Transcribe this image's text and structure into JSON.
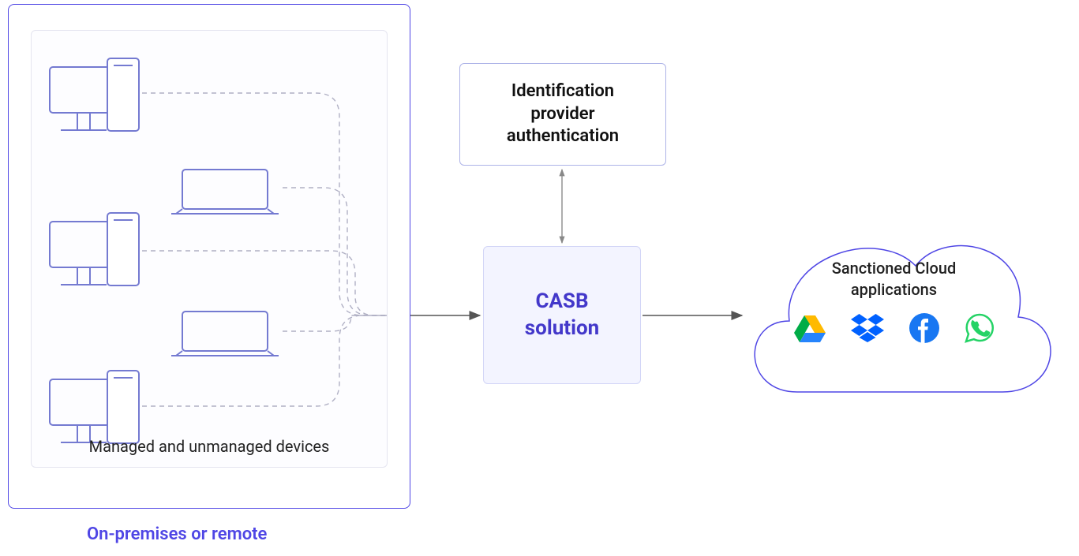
{
  "onprem": {
    "panel_label": "Managed and unmanaged devices",
    "footer_label": "On-premises or remote"
  },
  "idp": {
    "label": "Identification\nprovider\nauthentication"
  },
  "casb": {
    "label": "CASB\nsolution"
  },
  "cloud": {
    "title": "Sanctioned Cloud\napplications",
    "apps": [
      "google-drive",
      "dropbox",
      "facebook",
      "whatsapp"
    ]
  },
  "colors": {
    "accent": "#4f46e5",
    "casb_text": "#4338ca",
    "icon_stroke": "#747ad1",
    "dashed": "#b0b0c4"
  }
}
